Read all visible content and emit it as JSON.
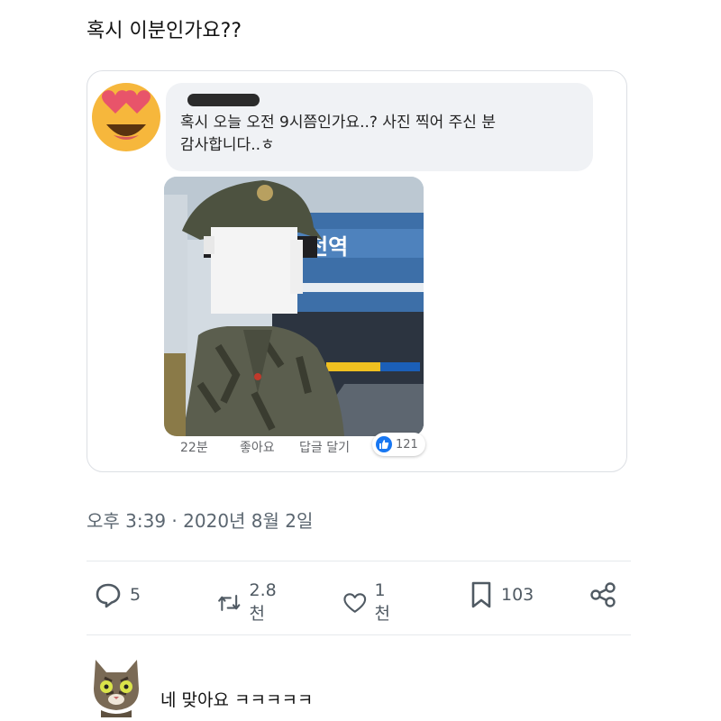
{
  "tweet": {
    "text": "혹시 이분인가요??",
    "timestamp": "오후 3:39 · 2020년 8월 2일"
  },
  "quoted_comment": {
    "avatar_icon": "heart-eyes-emoji-icon",
    "text": "혹시 오늘 오전 9시쯤인가요..? 사진 찍어 주신 분\n감사합니다..ㅎ",
    "photo_sign_text": "전역",
    "meta": {
      "time": "22분",
      "like_label": "좋아요",
      "reply_label": "답글 달기",
      "like_count": "121"
    }
  },
  "actions": {
    "reply_count": "5",
    "retweet_count": "2.8천",
    "like_count": "1천",
    "bookmark_count": "103",
    "reply_icon": "speech-bubble-icon",
    "retweet_icon": "retweet-icon",
    "like_icon": "heart-icon",
    "bookmark_icon": "bookmark-icon",
    "share_icon": "share-icon"
  },
  "reply": {
    "avatar_icon": "cat-avatar-icon",
    "text": "네 맞아요 ㅋㅋㅋㅋㅋ"
  },
  "colors": {
    "facebook_blue": "#1877f2",
    "muted_text": "#5b6670",
    "bubble_bg": "#f0f2f5"
  }
}
